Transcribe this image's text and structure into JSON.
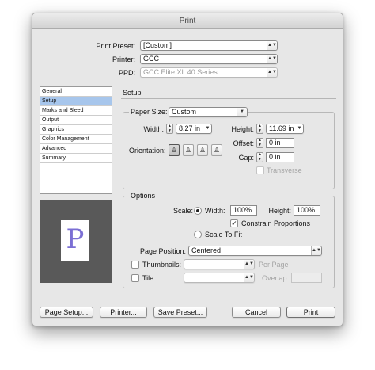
{
  "window": {
    "title": "Print"
  },
  "top": {
    "print_preset_label": "Print Preset:",
    "print_preset_value": "[Custom]",
    "printer_label": "Printer:",
    "printer_value": "GCC",
    "ppd_label": "PPD:",
    "ppd_value": "GCC Elite XL 40 Series"
  },
  "categories": [
    "General",
    "Setup",
    "Marks and Bleed",
    "Output",
    "Graphics",
    "Color Management",
    "Advanced",
    "Summary"
  ],
  "selected_category": "Setup",
  "preview": {
    "glyph": "P"
  },
  "setup": {
    "heading": "Setup",
    "paper_size_label": "Paper Size:",
    "paper_size_value": "Custom",
    "width_label": "Width:",
    "width_value": "8.27 in",
    "height_label": "Height:",
    "height_value": "11.69 in",
    "offset_label": "Offset:",
    "offset_value": "0 in",
    "gap_label": "Gap:",
    "gap_value": "0 in",
    "orientation_label": "Orientation:",
    "orientation_icons": [
      "portrait-icon",
      "landscape-icon",
      "reverse-portrait-icon",
      "reverse-landscape-icon"
    ],
    "orientation_glyphs": [
      "♙",
      "♙",
      "♙",
      "♙"
    ],
    "transverse_label": "Transverse",
    "transverse_checked": false
  },
  "options": {
    "heading": "Options",
    "scale_label": "Scale:",
    "scale_width_label": "Width:",
    "scale_width_value": "100%",
    "scale_height_label": "Height:",
    "scale_height_value": "100%",
    "constrain_label": "Constrain Proportions",
    "constrain_checked": true,
    "scale_to_fit_label": "Scale To Fit",
    "page_position_label": "Page Position:",
    "page_position_value": "Centered",
    "thumbnails_label": "Thumbnails:",
    "per_page_label": "Per Page",
    "tile_label": "Tile:",
    "overlap_label": "Overlap:"
  },
  "buttons": {
    "page_setup": "Page Setup...",
    "printer": "Printer...",
    "save_preset": "Save Preset...",
    "cancel": "Cancel",
    "print": "Print"
  },
  "icons": {
    "check": "✓",
    "arrow_down": "▼",
    "arrows_updown": "▲▼",
    "stepper_up": "▲",
    "stepper_down": "▼"
  },
  "colors": {
    "selection": "#a7c6ec",
    "preview_bg": "#595959",
    "preview_glyph": "#7b6fd4"
  }
}
